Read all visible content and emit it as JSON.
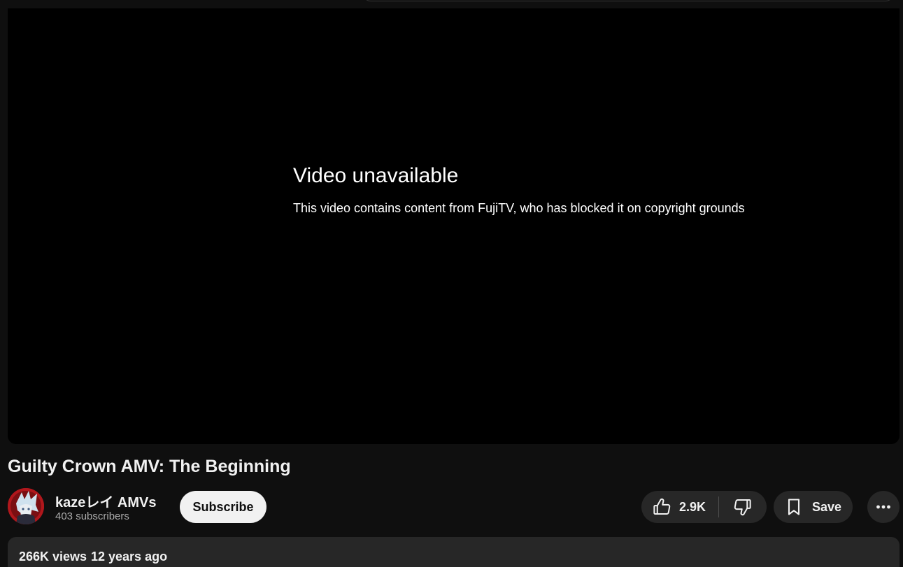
{
  "player": {
    "error_title": "Video unavailable",
    "error_message": "This video contains content from FujiTV, who has blocked it on copyright grounds"
  },
  "video": {
    "title": "Guilty Crown AMV: The Beginning"
  },
  "channel": {
    "name": "kazeレイ AMVs",
    "subscribers": "403 subscribers",
    "subscribe_label": "Subscribe"
  },
  "actions": {
    "like_count": "2.9K",
    "save_label": "Save",
    "like_icon": "thumbs-up-icon",
    "dislike_icon": "thumbs-down-icon",
    "save_icon": "bookmark-icon",
    "more_icon": "more-horizontal-icon"
  },
  "description": {
    "views": "266K views",
    "age": "12 years ago"
  },
  "colors": {
    "background": "#0f0f0f",
    "player": "#000000",
    "pill": "#272727",
    "subscribe_bg": "#f1f1f1",
    "avatar_red": "#b0171c"
  }
}
